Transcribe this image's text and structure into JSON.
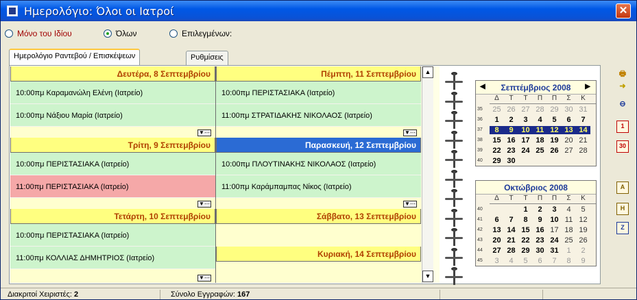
{
  "window": {
    "title": "Ημερολόγιο: Όλοι οι Ιατροί",
    "close_label": "✕"
  },
  "options": [
    {
      "label": "Μόνο του Ιδίου",
      "selected": false
    },
    {
      "label": "Όλων",
      "selected": true
    },
    {
      "label": "Επιλεγμένων:",
      "selected": false
    }
  ],
  "tabs": [
    {
      "label": "Ημερολόγιο Ραντεβού / Επισκέψεων",
      "active": true
    },
    {
      "label": "Ρυθμίσεις",
      "active": false
    }
  ],
  "days": [
    {
      "header": "Δευτέρα, 8 Σεπτεμβρίου",
      "selected": false,
      "appointments": [
        {
          "text": "10:00πμ Καραμανώλη Ελένη (Ιατρείο)",
          "status": "normal"
        },
        {
          "text": "10:00πμ Νάξιου Μαρία (Ιατρείο)",
          "status": "normal"
        }
      ]
    },
    {
      "header": "Τρίτη, 9 Σεπτεμβρίου",
      "selected": false,
      "appointments": [
        {
          "text": "10:00πμ ΠΕΡΙΣΤΑΣΙΑΚΑ  (Ιατρείο)",
          "status": "normal"
        },
        {
          "text": "11:00πμ ΠΕΡΙΣΤΑΣΙΑΚΑ  (Ιατρείο)",
          "status": "alert"
        }
      ]
    },
    {
      "header": "Τετάρτη, 10 Σεπτεμβρίου",
      "selected": false,
      "appointments": [
        {
          "text": "10:00πμ ΠΕΡΙΣΤΑΣΙΑΚΑ  (Ιατρείο)",
          "status": "normal"
        },
        {
          "text": "11:00πμ ΚΟΛΛΙΑΣ ΔΗΜΗΤΡΙΟΣ (Ιατρείο)",
          "status": "normal"
        }
      ]
    },
    {
      "header": "Πέμπτη, 11 Σεπτεμβρίου",
      "selected": false,
      "appointments": [
        {
          "text": "10:00πμ ΠΕΡΙΣΤΑΣΙΑΚΑ  (Ιατρείο)",
          "status": "normal"
        },
        {
          "text": "11:00πμ ΣΤΡΑΤΙΔΑΚΗΣ ΝΙΚΟΛΑΟΣ (Ιατρείο)",
          "status": "normal"
        }
      ]
    },
    {
      "header": "Παρασκευή, 12 Σεπτεμβρίου",
      "selected": true,
      "appointments": [
        {
          "text": "10:00πμ ΠΛΟΥΤΙΝΑΚΗΣ ΝΙΚΟΛΑΟΣ (Ιατρείο)",
          "status": "normal"
        },
        {
          "text": "11:00πμ Καράμπαμπας Νίκος (Ιατρείο)",
          "status": "normal"
        }
      ]
    },
    {
      "header": "Σάββατο, 13 Σεπτεμβρίου",
      "selected": false,
      "appointments": []
    },
    {
      "header": "Κυριακή, 14 Σεπτεμβρίου",
      "selected": false,
      "appointments": []
    }
  ],
  "more_icon": "▼⋯",
  "scroll": {
    "up": "▲",
    "down": "▼"
  },
  "weekday_headers": [
    "Δ",
    "Τ",
    "Τ",
    "Π",
    "Π",
    "Σ",
    "Κ"
  ],
  "calendars": [
    {
      "title": "Σεπτέμβριος 2008",
      "prev": "◀",
      "next": "▶",
      "weeks": [
        {
          "week": "35",
          "days": [
            {
              "d": "25",
              "s": "g"
            },
            {
              "d": "26",
              "s": "g"
            },
            {
              "d": "27",
              "s": "g"
            },
            {
              "d": "28",
              "s": "g"
            },
            {
              "d": "29",
              "s": "g"
            },
            {
              "d": "30",
              "s": "g"
            },
            {
              "d": "31",
              "s": "g"
            }
          ]
        },
        {
          "week": "36",
          "days": [
            {
              "d": "1",
              "s": "b"
            },
            {
              "d": "2",
              "s": "b"
            },
            {
              "d": "3",
              "s": "b"
            },
            {
              "d": "4",
              "s": "b"
            },
            {
              "d": "5",
              "s": "b"
            },
            {
              "d": "6",
              "s": "b"
            },
            {
              "d": "7",
              "s": "b"
            }
          ]
        },
        {
          "week": "37",
          "days": [
            {
              "d": "8",
              "s": "hl"
            },
            {
              "d": "9",
              "s": "hl"
            },
            {
              "d": "10",
              "s": "hl"
            },
            {
              "d": "11",
              "s": "hl"
            },
            {
              "d": "12",
              "s": "hl"
            },
            {
              "d": "13",
              "s": "hl"
            },
            {
              "d": "14",
              "s": "hl"
            }
          ]
        },
        {
          "week": "38",
          "days": [
            {
              "d": "15",
              "s": "b"
            },
            {
              "d": "16",
              "s": "b"
            },
            {
              "d": "17",
              "s": "b"
            },
            {
              "d": "18",
              "s": "b"
            },
            {
              "d": "19",
              "s": "b"
            },
            {
              "d": "20",
              "s": ""
            },
            {
              "d": "21",
              "s": ""
            }
          ]
        },
        {
          "week": "39",
          "days": [
            {
              "d": "22",
              "s": "b"
            },
            {
              "d": "23",
              "s": "b"
            },
            {
              "d": "24",
              "s": "b"
            },
            {
              "d": "25",
              "s": "b"
            },
            {
              "d": "26",
              "s": "b"
            },
            {
              "d": "27",
              "s": ""
            },
            {
              "d": "28",
              "s": ""
            }
          ]
        },
        {
          "week": "40",
          "days": [
            {
              "d": "29",
              "s": "b"
            },
            {
              "d": "30",
              "s": "b"
            },
            {
              "d": "",
              "s": ""
            },
            {
              "d": "",
              "s": ""
            },
            {
              "d": "",
              "s": ""
            },
            {
              "d": "",
              "s": ""
            },
            {
              "d": "",
              "s": ""
            }
          ]
        }
      ]
    },
    {
      "title": "Οκτώβριος 2008",
      "prev": "",
      "next": "",
      "weeks": [
        {
          "week": "40",
          "days": [
            {
              "d": "",
              "s": ""
            },
            {
              "d": "",
              "s": ""
            },
            {
              "d": "1",
              "s": "b"
            },
            {
              "d": "2",
              "s": "b"
            },
            {
              "d": "3",
              "s": "b"
            },
            {
              "d": "4",
              "s": ""
            },
            {
              "d": "5",
              "s": ""
            }
          ]
        },
        {
          "week": "41",
          "days": [
            {
              "d": "6",
              "s": "b"
            },
            {
              "d": "7",
              "s": "b"
            },
            {
              "d": "8",
              "s": "b"
            },
            {
              "d": "9",
              "s": "b"
            },
            {
              "d": "10",
              "s": "b"
            },
            {
              "d": "11",
              "s": ""
            },
            {
              "d": "12",
              "s": ""
            }
          ]
        },
        {
          "week": "42",
          "days": [
            {
              "d": "13",
              "s": "b"
            },
            {
              "d": "14",
              "s": "b"
            },
            {
              "d": "15",
              "s": "b"
            },
            {
              "d": "16",
              "s": "b"
            },
            {
              "d": "17",
              "s": ""
            },
            {
              "d": "18",
              "s": ""
            },
            {
              "d": "19",
              "s": ""
            }
          ]
        },
        {
          "week": "43",
          "days": [
            {
              "d": "20",
              "s": "b"
            },
            {
              "d": "21",
              "s": "b"
            },
            {
              "d": "22",
              "s": "b"
            },
            {
              "d": "23",
              "s": "b"
            },
            {
              "d": "24",
              "s": "b"
            },
            {
              "d": "25",
              "s": ""
            },
            {
              "d": "26",
              "s": ""
            }
          ]
        },
        {
          "week": "44",
          "days": [
            {
              "d": "27",
              "s": "b"
            },
            {
              "d": "28",
              "s": "b"
            },
            {
              "d": "29",
              "s": "b"
            },
            {
              "d": "30",
              "s": "b"
            },
            {
              "d": "31",
              "s": "b"
            },
            {
              "d": "1",
              "s": "g"
            },
            {
              "d": "2",
              "s": "g"
            }
          ]
        },
        {
          "week": "45",
          "days": [
            {
              "d": "3",
              "s": "g"
            },
            {
              "d": "4",
              "s": "g"
            },
            {
              "d": "5",
              "s": "g"
            },
            {
              "d": "6",
              "s": "g"
            },
            {
              "d": "7",
              "s": "g"
            },
            {
              "d": "8",
              "s": "g"
            },
            {
              "d": "9",
              "s": "g"
            }
          ]
        }
      ]
    }
  ],
  "toolbar": [
    {
      "name": "print-icon",
      "glyph": "🖶",
      "color": "#c08000"
    },
    {
      "name": "go-to-today-icon",
      "glyph": "➜",
      "color": "#c0a000"
    },
    {
      "name": "zoom-out-icon",
      "glyph": "⊖",
      "color": "#1c3a9a"
    },
    {
      "name": "day-view-icon",
      "glyph": "1",
      "color": "#c00000"
    },
    {
      "name": "month-view-icon",
      "glyph": "30",
      "color": "#c00000"
    },
    {
      "name": "calendar-a-icon",
      "glyph": "A",
      "color": "#806000"
    },
    {
      "name": "calendar-h-icon",
      "glyph": "H",
      "color": "#806000"
    },
    {
      "name": "calendar-z-icon",
      "glyph": "Z",
      "color": "#1c3a9a"
    }
  ],
  "status": {
    "users_label": "Διακριτοί Χειριστές:",
    "users_value": "2",
    "records_label": "Σύνολο Εγγραφών:",
    "records_value": "167"
  }
}
